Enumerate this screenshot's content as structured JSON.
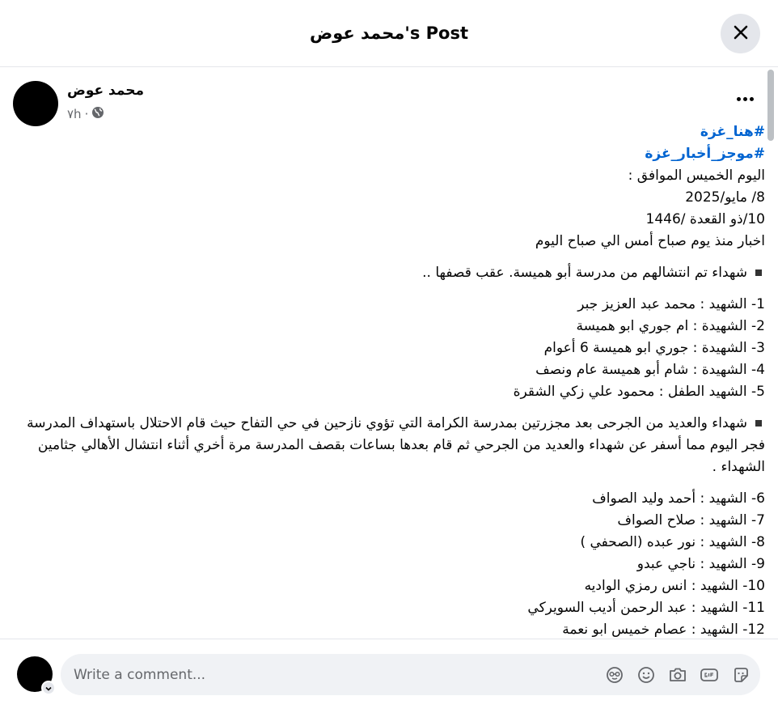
{
  "dialog": {
    "title": "محمد عوض's Post"
  },
  "post": {
    "author": "محمد عوض",
    "time": "٧h",
    "hashtags": [
      "#هنا_غزة",
      "#موجز_أخبار_غزة"
    ],
    "header_lines": [
      "اليوم الخميس الموافق :",
      "8/ مايو/2025",
      "10/ذو القعدة /1446",
      "اخبار منذ يوم صباح أمس الي صباح اليوم"
    ],
    "section1_intro": "شهداء تم انتشالهم من مدرسة أبو هميسة. عقب قصفها ..",
    "section1_list": [
      "1- الشهيد : محمد عبد العزيز جبر",
      "2- الشهيدة : ام جوري ابو هميسة",
      "3- الشهيدة : جوري ابو هميسة 6 أعوام",
      "4- الشهيدة : شام أبو هميسة عام ونصف",
      "5- الشهيد الطفل : محمود علي زكي الشقرة"
    ],
    "section2_intro": "شهداء  والعديد من الجرحى بعد مجزرتين بمدرسة الكرامة التي تؤوي نازحين في حي التفاح حيث قام الاحتلال باستهداف المدرسة فجر اليوم مما أسفر عن شهداء والعديد من الجرحي ثم قام بعدها بساعات بقصف المدرسة مرة أخري أثناء انتشال الأهالي جثامين الشهداء .",
    "section2_list": [
      "6- الشهيد : أحمد وليد الصواف",
      "7- الشهيد : صلاح الصواف",
      "8- الشهيد  : نور عبده (الصحفي )",
      "9- الشهيد : ناجي عبدو",
      "10- الشهيد : انس رمزي الواديه",
      "11- الشهيد : عبد الرحمن أديب السويركي",
      "12- الشهيد : عصام خميس ابو نعمة"
    ]
  },
  "comment": {
    "placeholder": "Write a comment..."
  },
  "icons": {
    "close": "close-icon",
    "more": "more-options-icon",
    "privacy": "globe-icon",
    "comment_tools": [
      "avatar-sticker-icon",
      "emoji-icon",
      "camera-icon",
      "gif-icon",
      "sticker-icon"
    ]
  },
  "colors": {
    "hashtag": "#0064d1",
    "secondary_text": "#65676b",
    "button_bg": "#e4e6eb",
    "input_bg": "#f0f2f5"
  }
}
